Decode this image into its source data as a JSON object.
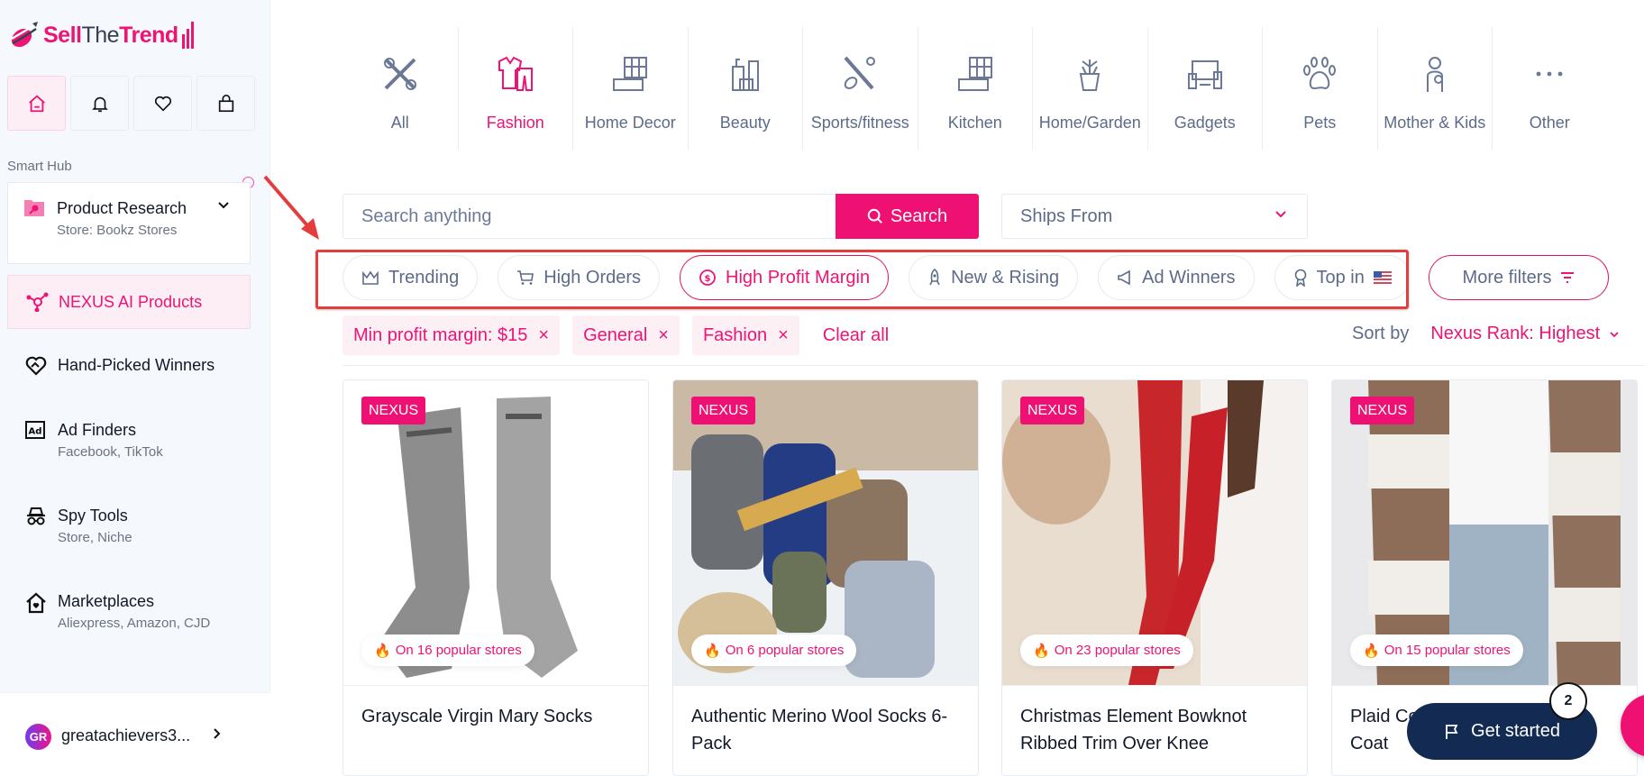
{
  "brand": {
    "part1": "Sell",
    "part2": "The",
    "part3": "Trend"
  },
  "quick_actions": [
    {
      "name": "home",
      "icon": "home-icon",
      "active": true
    },
    {
      "name": "notifications",
      "icon": "bell-icon"
    },
    {
      "name": "favorites",
      "icon": "heart-icon"
    },
    {
      "name": "cart",
      "icon": "shopping-bag-icon"
    }
  ],
  "sidebar": {
    "section_label": "Smart Hub",
    "product_research": {
      "title": "Product Research",
      "subtitle": "Store: Bookz Stores"
    },
    "items": [
      {
        "label": "NEXUS AI Products",
        "sub": "",
        "active": true,
        "icon": "nexus-network-icon"
      },
      {
        "label": "Hand-Picked Winners",
        "sub": "",
        "icon": "heart-handshake-icon"
      },
      {
        "label": "Ad Finders",
        "sub": "Facebook, TikTok",
        "icon": "ad-icon"
      },
      {
        "label": "Spy Tools",
        "sub": "Store, Niche",
        "icon": "spy-icon"
      },
      {
        "label": "Marketplaces",
        "sub": "Aliexpress, Amazon, CJD",
        "icon": "house-heart-icon"
      }
    ],
    "user": {
      "initials": "GR",
      "name": "greatachievers3..."
    }
  },
  "categories": [
    {
      "label": "All",
      "icon": "tools-icon"
    },
    {
      "label": "Fashion",
      "icon": "clothes-icon",
      "active": true
    },
    {
      "label": "Home Decor",
      "icon": "living-room-icon"
    },
    {
      "label": "Beauty",
      "icon": "cosmetics-icon"
    },
    {
      "label": "Sports/fitness",
      "icon": "sports-icon"
    },
    {
      "label": "Kitchen",
      "icon": "kitchen-icon"
    },
    {
      "label": "Home/Garden",
      "icon": "plant-pot-icon"
    },
    {
      "label": "Gadgets",
      "icon": "devices-icon"
    },
    {
      "label": "Pets",
      "icon": "paw-icon"
    },
    {
      "label": "Mother & Kids",
      "icon": "mother-child-icon"
    },
    {
      "label": "Other",
      "icon": "more-dots-icon"
    }
  ],
  "search": {
    "placeholder": "Search anything",
    "button_label": "Search",
    "ships_from": "Ships From"
  },
  "quick_filters": [
    {
      "label": "Trending",
      "icon": "crown-icon"
    },
    {
      "label": "High Orders",
      "icon": "cart-icon"
    },
    {
      "label": "High Profit Margin",
      "icon": "dollar-coin-icon",
      "active": true
    },
    {
      "label": "New & Rising",
      "icon": "rocket-icon"
    },
    {
      "label": "Ad Winners",
      "icon": "megaphone-icon"
    },
    {
      "label": "Top in",
      "icon": "award-icon",
      "flag": "us-flag-icon"
    }
  ],
  "more_filters_label": "More filters",
  "active_filters": [
    "Min profit margin: $15",
    "General",
    "Fashion"
  ],
  "clear_all_label": "Clear all",
  "sort": {
    "label": "Sort by",
    "value": "Nexus Rank: Highest"
  },
  "products": [
    {
      "badge": "NEXUS",
      "popular": "On 16 popular stores",
      "name": "Grayscale Virgin Mary Socks"
    },
    {
      "badge": "NEXUS",
      "popular": "On 6 popular stores",
      "name": "Authentic Merino Wool Socks 6-Pack"
    },
    {
      "badge": "NEXUS",
      "popular": "On 23 popular stores",
      "name": "Christmas Element Bowknot Ribbed Trim Over Knee"
    },
    {
      "badge": "NEXUS",
      "popular": "On 15 popular stores",
      "name": "Plaid Corduroy Button Down Coat"
    }
  ],
  "get_started": {
    "label": "Get started",
    "count": "2"
  },
  "colors": {
    "accent": "#ee1173",
    "text_muted": "#5d6b8a",
    "navy": "#132b53",
    "annotation_red": "#e43d3d"
  }
}
